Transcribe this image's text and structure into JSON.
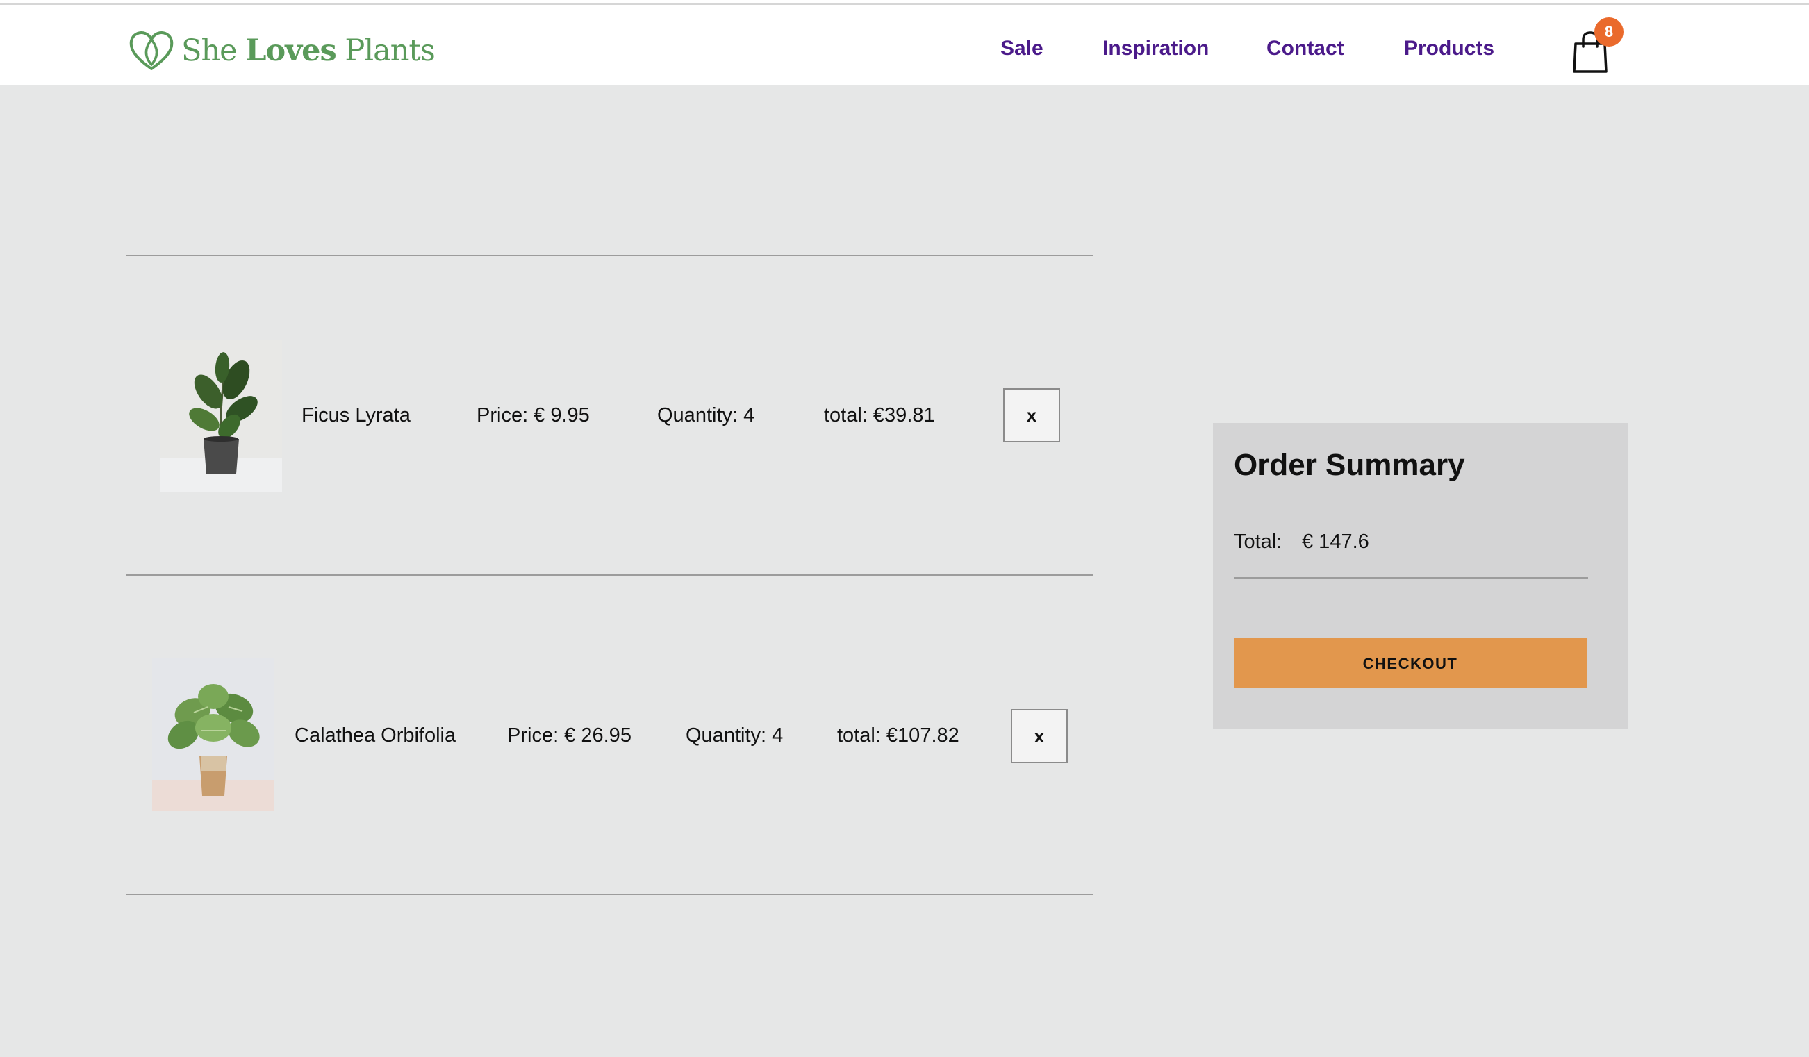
{
  "brand": {
    "name_part1": "She",
    "name_part2": "Loves",
    "name_part3": "Plants",
    "color": "#5a9a5a"
  },
  "nav": {
    "color": "#4b1a8a",
    "items": [
      {
        "label": "Sale"
      },
      {
        "label": "Inspiration"
      },
      {
        "label": "Contact"
      },
      {
        "label": "Products"
      }
    ]
  },
  "cart": {
    "icon": "shopping-bag-icon",
    "count": "8",
    "badge_color": "#ea6a2c"
  },
  "items": [
    {
      "name": "Ficus Lyrata",
      "price": "Price: € 9.95",
      "quantity": "Quantity: 4",
      "total": "total: €39.81",
      "remove_label": "x",
      "image": "ficus-lyrata-plant"
    },
    {
      "name": "Calathea Orbifolia",
      "price": "Price: € 26.95",
      "quantity": "Quantity: 4",
      "total": "total: €107.82",
      "remove_label": "x",
      "image": "calathea-orbifolia-plant"
    }
  ],
  "summary": {
    "title": "Order Summary",
    "total_label": "Total:",
    "total_value": "€ 147.6",
    "checkout_label": "CHECKOUT",
    "checkout_color": "#e2974d"
  }
}
